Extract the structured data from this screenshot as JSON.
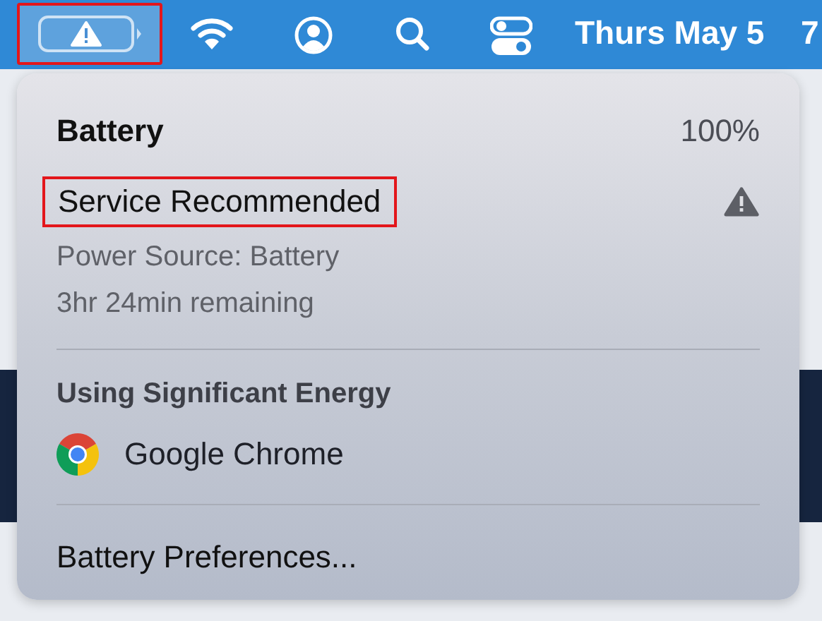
{
  "menu_bar": {
    "battery_highlighted": true,
    "date": "Thurs May 5",
    "clock_cut": "7"
  },
  "battery_menu": {
    "title": "Battery",
    "percent": "100%",
    "status": {
      "text": "Service Recommended",
      "highlighted": true,
      "warning": true
    },
    "power_source": "Power Source: Battery",
    "remaining": "3hr 24min remaining",
    "section_heading": "Using Significant Energy",
    "apps": [
      {
        "name": "Google Chrome",
        "kind": "chrome"
      }
    ],
    "preferences": "Battery Preferences..."
  }
}
